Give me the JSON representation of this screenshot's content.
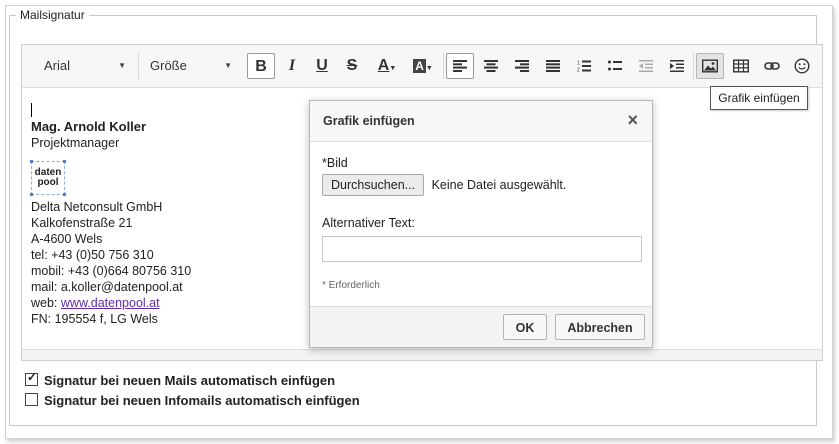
{
  "section": {
    "legend": "Mailsignatur"
  },
  "toolbar": {
    "font_select": "Arial",
    "size_select": "Größe",
    "buttons": [
      {
        "name": "bold-button",
        "icon": "bold-icon",
        "glyph": "B"
      },
      {
        "name": "italic-button",
        "icon": "italic-icon",
        "glyph": "I"
      },
      {
        "name": "underline-button",
        "icon": "underline-icon",
        "glyph": "U"
      },
      {
        "name": "strikethrough-button",
        "icon": "strikethrough-icon",
        "glyph": "S"
      }
    ],
    "text_color_glyph": "A",
    "bg_color_glyph": "A"
  },
  "tooltip": {
    "text": "Grafik einfügen"
  },
  "signature": {
    "name": "Mag. Arnold Koller",
    "role": "Projektmanager",
    "logo_line1": "daten",
    "logo_line2": "pool",
    "lines": [
      "Delta Netconsult GmbH",
      "Kalkofenstraße 21",
      "A-4600 Wels",
      "tel: +43 (0)50 756 310",
      "mobil: +43 (0)664 80756 310",
      "mail: a.koller@datenpool.at"
    ],
    "web_prefix": "web: ",
    "web_link": "www.datenpool.at",
    "fn": "FN: 195554 f, LG Wels"
  },
  "dialog": {
    "title": "Grafik einfügen",
    "close": "×",
    "image_label": "*Bild",
    "browse_button": "Durchsuchen...",
    "file_status": "Keine Datei ausgewählt.",
    "alt_label": "Alternativer Text:",
    "alt_value": "",
    "required_note": "* Erforderlich",
    "ok_button": "OK",
    "cancel_button": "Abbrechen"
  },
  "options": {
    "auto_insert_mail": {
      "label": "Signatur bei neuen Mails automatisch einfügen",
      "checked": true
    },
    "auto_insert_infomail": {
      "label": "Signatur bei neuen Infomails automatisch einfügen",
      "checked": false
    }
  }
}
